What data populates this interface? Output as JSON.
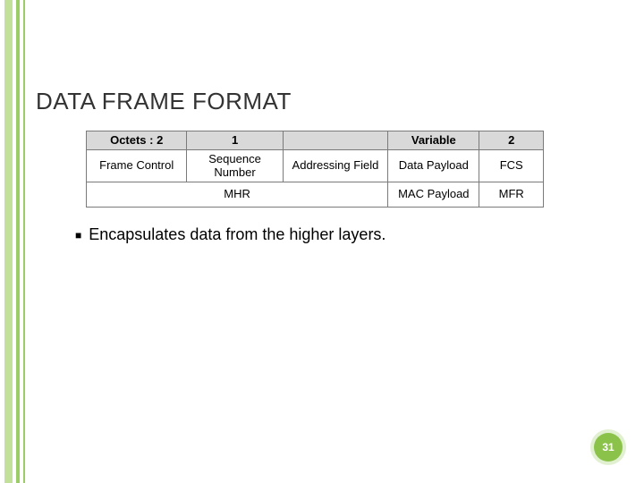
{
  "title": "DATA FRAME FORMAT",
  "table": {
    "header": [
      "Octets : 2",
      "1",
      "",
      "Variable",
      "2"
    ],
    "row1": [
      "Frame Control",
      "Sequence Number",
      "Addressing Field",
      "Data Payload",
      "FCS"
    ],
    "row2_merged": "MHR",
    "row2_cell3": "MAC Payload",
    "row2_cell4": "MFR"
  },
  "bullet": "Encapsulates data from the higher layers.",
  "page_number": "31"
}
